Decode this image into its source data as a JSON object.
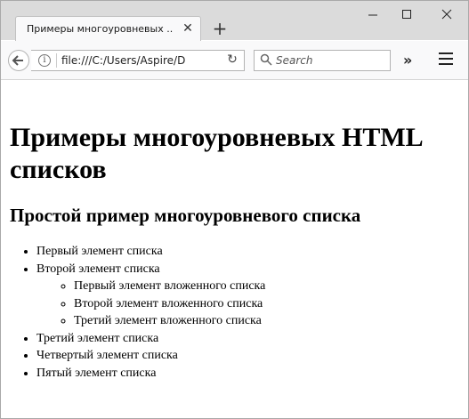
{
  "tab": {
    "title": "Примеры многоуровневых ...",
    "close": "✕"
  },
  "new_tab": "+",
  "window_controls": {
    "minimize": "—",
    "maximize": "☐",
    "close": "✕"
  },
  "address": {
    "url": "file:///C:/Users/Aspire/D"
  },
  "search": {
    "placeholder": "Search"
  },
  "overflow": "»",
  "page": {
    "h1": "Примеры многоуровневых HTML списков",
    "h2": "Простой пример многоуровневого списка",
    "list": {
      "item1": "Первый элемент списка",
      "item2": "Второй элемент списка",
      "nested": [
        "Первый элемент вложенного списка",
        "Второй элемент вложенного списка",
        "Третий элемент вложенного списка"
      ],
      "item3": "Третий элемент списка",
      "item4": "Четвертый элемент списка",
      "item5": "Пятый элемент списка"
    }
  }
}
